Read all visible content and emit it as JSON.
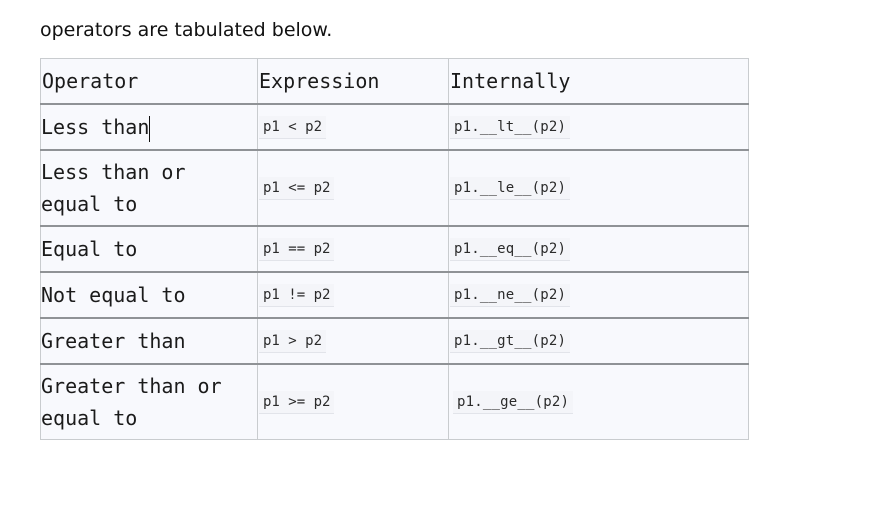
{
  "intro_text": "operators are tabulated below.",
  "table": {
    "headers": {
      "operator": "Operator",
      "expression": "Expression",
      "internally": "Internally"
    },
    "rows": [
      {
        "operator": "Less than",
        "expression": "p1 < p2",
        "internally": "p1.__lt__(p2)"
      },
      {
        "operator": "Less than or equal to",
        "expression": "p1 <= p2",
        "internally": "p1.__le__(p2)"
      },
      {
        "operator": "Equal to",
        "expression": "p1 == p2",
        "internally": "p1.__eq__(p2)"
      },
      {
        "operator": "Not equal to",
        "expression": "p1 != p2",
        "internally": "p1.__ne__(p2)"
      },
      {
        "operator": "Greater than",
        "expression": "p1 > p2",
        "internally": "p1.__gt__(p2)"
      },
      {
        "operator": "Greater than or equal to",
        "expression": "p1 >= p2",
        "internally": "p1.__ge__(p2)"
      }
    ]
  }
}
